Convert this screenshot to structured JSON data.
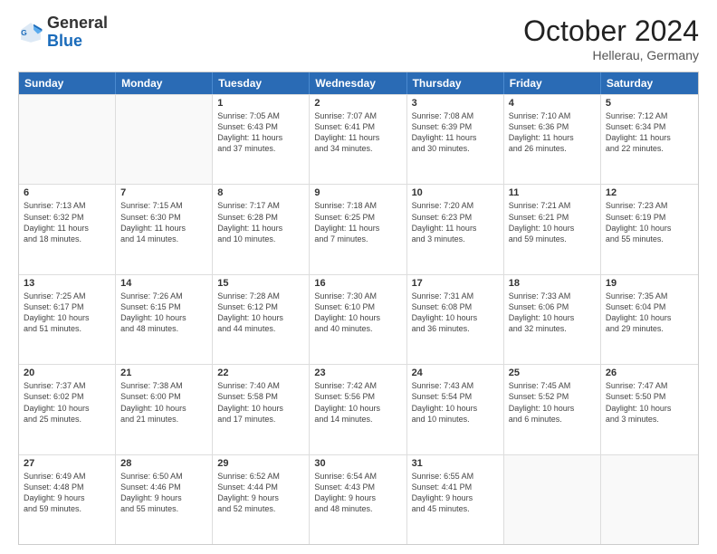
{
  "header": {
    "logo_general": "General",
    "logo_blue": "Blue",
    "month_title": "October 2024",
    "location": "Hellerau, Germany"
  },
  "weekdays": [
    "Sunday",
    "Monday",
    "Tuesday",
    "Wednesday",
    "Thursday",
    "Friday",
    "Saturday"
  ],
  "rows": [
    [
      {
        "day": "",
        "lines": []
      },
      {
        "day": "",
        "lines": []
      },
      {
        "day": "1",
        "lines": [
          "Sunrise: 7:05 AM",
          "Sunset: 6:43 PM",
          "Daylight: 11 hours",
          "and 37 minutes."
        ]
      },
      {
        "day": "2",
        "lines": [
          "Sunrise: 7:07 AM",
          "Sunset: 6:41 PM",
          "Daylight: 11 hours",
          "and 34 minutes."
        ]
      },
      {
        "day": "3",
        "lines": [
          "Sunrise: 7:08 AM",
          "Sunset: 6:39 PM",
          "Daylight: 11 hours",
          "and 30 minutes."
        ]
      },
      {
        "day": "4",
        "lines": [
          "Sunrise: 7:10 AM",
          "Sunset: 6:36 PM",
          "Daylight: 11 hours",
          "and 26 minutes."
        ]
      },
      {
        "day": "5",
        "lines": [
          "Sunrise: 7:12 AM",
          "Sunset: 6:34 PM",
          "Daylight: 11 hours",
          "and 22 minutes."
        ]
      }
    ],
    [
      {
        "day": "6",
        "lines": [
          "Sunrise: 7:13 AM",
          "Sunset: 6:32 PM",
          "Daylight: 11 hours",
          "and 18 minutes."
        ]
      },
      {
        "day": "7",
        "lines": [
          "Sunrise: 7:15 AM",
          "Sunset: 6:30 PM",
          "Daylight: 11 hours",
          "and 14 minutes."
        ]
      },
      {
        "day": "8",
        "lines": [
          "Sunrise: 7:17 AM",
          "Sunset: 6:28 PM",
          "Daylight: 11 hours",
          "and 10 minutes."
        ]
      },
      {
        "day": "9",
        "lines": [
          "Sunrise: 7:18 AM",
          "Sunset: 6:25 PM",
          "Daylight: 11 hours",
          "and 7 minutes."
        ]
      },
      {
        "day": "10",
        "lines": [
          "Sunrise: 7:20 AM",
          "Sunset: 6:23 PM",
          "Daylight: 11 hours",
          "and 3 minutes."
        ]
      },
      {
        "day": "11",
        "lines": [
          "Sunrise: 7:21 AM",
          "Sunset: 6:21 PM",
          "Daylight: 10 hours",
          "and 59 minutes."
        ]
      },
      {
        "day": "12",
        "lines": [
          "Sunrise: 7:23 AM",
          "Sunset: 6:19 PM",
          "Daylight: 10 hours",
          "and 55 minutes."
        ]
      }
    ],
    [
      {
        "day": "13",
        "lines": [
          "Sunrise: 7:25 AM",
          "Sunset: 6:17 PM",
          "Daylight: 10 hours",
          "and 51 minutes."
        ]
      },
      {
        "day": "14",
        "lines": [
          "Sunrise: 7:26 AM",
          "Sunset: 6:15 PM",
          "Daylight: 10 hours",
          "and 48 minutes."
        ]
      },
      {
        "day": "15",
        "lines": [
          "Sunrise: 7:28 AM",
          "Sunset: 6:12 PM",
          "Daylight: 10 hours",
          "and 44 minutes."
        ]
      },
      {
        "day": "16",
        "lines": [
          "Sunrise: 7:30 AM",
          "Sunset: 6:10 PM",
          "Daylight: 10 hours",
          "and 40 minutes."
        ]
      },
      {
        "day": "17",
        "lines": [
          "Sunrise: 7:31 AM",
          "Sunset: 6:08 PM",
          "Daylight: 10 hours",
          "and 36 minutes."
        ]
      },
      {
        "day": "18",
        "lines": [
          "Sunrise: 7:33 AM",
          "Sunset: 6:06 PM",
          "Daylight: 10 hours",
          "and 32 minutes."
        ]
      },
      {
        "day": "19",
        "lines": [
          "Sunrise: 7:35 AM",
          "Sunset: 6:04 PM",
          "Daylight: 10 hours",
          "and 29 minutes."
        ]
      }
    ],
    [
      {
        "day": "20",
        "lines": [
          "Sunrise: 7:37 AM",
          "Sunset: 6:02 PM",
          "Daylight: 10 hours",
          "and 25 minutes."
        ]
      },
      {
        "day": "21",
        "lines": [
          "Sunrise: 7:38 AM",
          "Sunset: 6:00 PM",
          "Daylight: 10 hours",
          "and 21 minutes."
        ]
      },
      {
        "day": "22",
        "lines": [
          "Sunrise: 7:40 AM",
          "Sunset: 5:58 PM",
          "Daylight: 10 hours",
          "and 17 minutes."
        ]
      },
      {
        "day": "23",
        "lines": [
          "Sunrise: 7:42 AM",
          "Sunset: 5:56 PM",
          "Daylight: 10 hours",
          "and 14 minutes."
        ]
      },
      {
        "day": "24",
        "lines": [
          "Sunrise: 7:43 AM",
          "Sunset: 5:54 PM",
          "Daylight: 10 hours",
          "and 10 minutes."
        ]
      },
      {
        "day": "25",
        "lines": [
          "Sunrise: 7:45 AM",
          "Sunset: 5:52 PM",
          "Daylight: 10 hours",
          "and 6 minutes."
        ]
      },
      {
        "day": "26",
        "lines": [
          "Sunrise: 7:47 AM",
          "Sunset: 5:50 PM",
          "Daylight: 10 hours",
          "and 3 minutes."
        ]
      }
    ],
    [
      {
        "day": "27",
        "lines": [
          "Sunrise: 6:49 AM",
          "Sunset: 4:48 PM",
          "Daylight: 9 hours",
          "and 59 minutes."
        ]
      },
      {
        "day": "28",
        "lines": [
          "Sunrise: 6:50 AM",
          "Sunset: 4:46 PM",
          "Daylight: 9 hours",
          "and 55 minutes."
        ]
      },
      {
        "day": "29",
        "lines": [
          "Sunrise: 6:52 AM",
          "Sunset: 4:44 PM",
          "Daylight: 9 hours",
          "and 52 minutes."
        ]
      },
      {
        "day": "30",
        "lines": [
          "Sunrise: 6:54 AM",
          "Sunset: 4:43 PM",
          "Daylight: 9 hours",
          "and 48 minutes."
        ]
      },
      {
        "day": "31",
        "lines": [
          "Sunrise: 6:55 AM",
          "Sunset: 4:41 PM",
          "Daylight: 9 hours",
          "and 45 minutes."
        ]
      },
      {
        "day": "",
        "lines": []
      },
      {
        "day": "",
        "lines": []
      }
    ]
  ]
}
